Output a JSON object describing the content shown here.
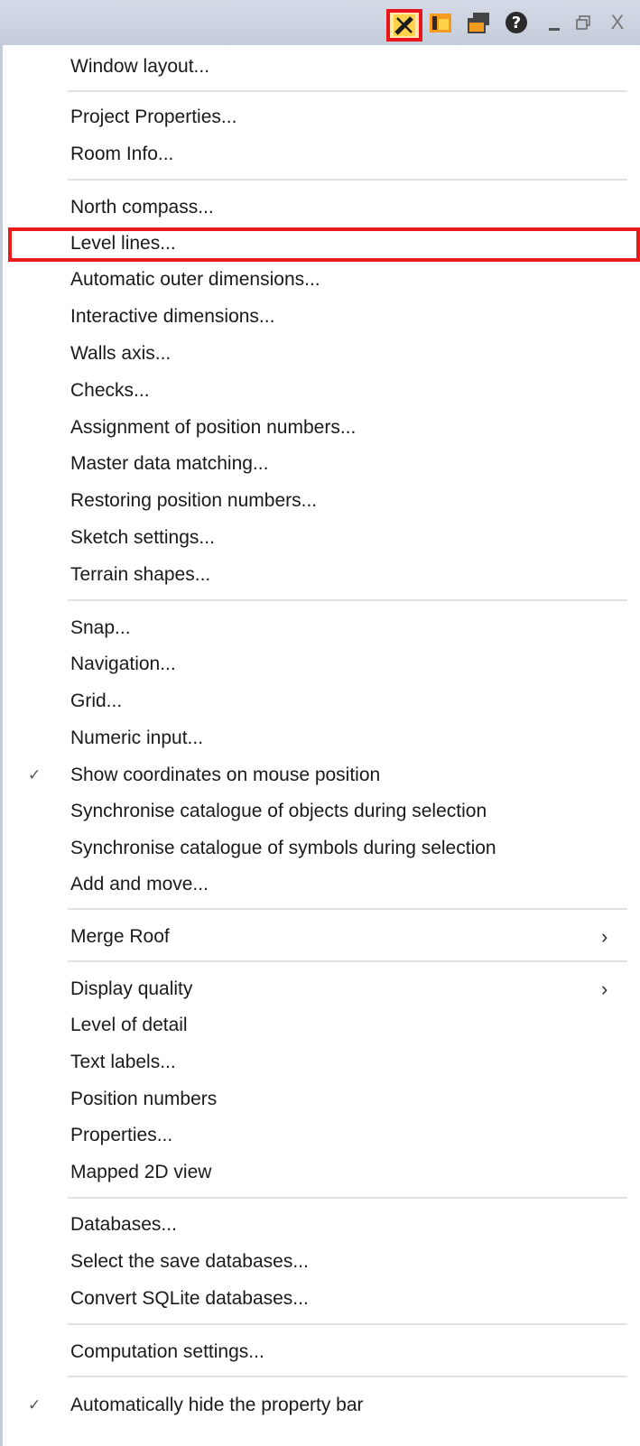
{
  "toolbar": {
    "icons": [
      "settings-icon",
      "panel-icon",
      "windows-icon",
      "help-icon",
      "minimize-icon",
      "restore-icon",
      "close-icon"
    ],
    "help_glyph": "?",
    "close_glyph": "X"
  },
  "menu": {
    "items": [
      {
        "label": "Window layout..."
      },
      {
        "label": "Project Properties..."
      },
      {
        "label": "Room Info..."
      },
      {
        "label": "North compass..."
      },
      {
        "label": "Level lines..."
      },
      {
        "label": "Automatic outer dimensions..."
      },
      {
        "label": "Interactive dimensions..."
      },
      {
        "label": "Walls axis..."
      },
      {
        "label": "Checks..."
      },
      {
        "label": "Assignment of position numbers..."
      },
      {
        "label": "Master data matching..."
      },
      {
        "label": "Restoring position numbers..."
      },
      {
        "label": "Sketch settings..."
      },
      {
        "label": "Terrain shapes..."
      },
      {
        "label": "Snap..."
      },
      {
        "label": "Navigation..."
      },
      {
        "label": "Grid..."
      },
      {
        "label": "Numeric input..."
      },
      {
        "label": "Show coordinates on mouse position",
        "checked": true
      },
      {
        "label": "Synchronise catalogue of objects during selection"
      },
      {
        "label": "Synchronise catalogue of symbols during selection"
      },
      {
        "label": "Add and move..."
      },
      {
        "label": "Merge Roof",
        "submenu": true
      },
      {
        "label": "Display quality",
        "submenu": true
      },
      {
        "label": "Level of detail"
      },
      {
        "label": "Text labels..."
      },
      {
        "label": "Position numbers"
      },
      {
        "label": "Properties..."
      },
      {
        "label": "Mapped 2D view"
      },
      {
        "label": "Databases..."
      },
      {
        "label": "Select the save databases..."
      },
      {
        "label": "Convert SQLite databases..."
      },
      {
        "label": "Computation settings..."
      },
      {
        "label": "Automatically hide the property bar",
        "checked": true
      }
    ],
    "check_glyph": "✓",
    "submenu_glyph": "›"
  }
}
